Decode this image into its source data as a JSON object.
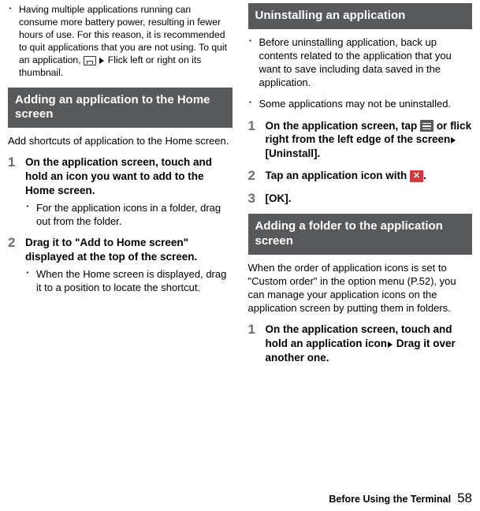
{
  "left": {
    "top_bullet": "Having multiple applications running can consume more battery power, resulting in fewer hours of use. For this reason, it is recommended to quit applications that you are not using. To quit an application, ",
    "top_bullet_after_icon": "Flick left or right on its thumbnail.",
    "heading1": "Adding an application to the Home screen",
    "intro1": "Add shortcuts of application to the Home screen.",
    "step1_title": "On the application screen, touch and hold an icon you want to add to the Home screen.",
    "step1_sub": "For the application icons in a folder, drag out from the folder.",
    "step2_title": "Drag it to \"Add to Home screen\" displayed at the top of the screen.",
    "step2_sub": "When the Home screen is displayed, drag it to a position to locate the shortcut."
  },
  "right": {
    "heading2": "Uninstalling an application",
    "bullet_a": "Before uninstalling application, back up contents related to the application that you want to save including data saved in the application.",
    "bullet_b": "Some applications may not be uninstalled.",
    "u_step1_a": "On the application screen, tap ",
    "u_step1_b": " or flick right from the left edge of the screen",
    "u_step1_c": "[Uninstall].",
    "u_step2": "Tap an application icon with ",
    "u_step2_end": ".",
    "u_step3": "[OK].",
    "heading3": "Adding a folder to the application screen",
    "intro3": "When the order of application icons is set to \"Custom order\" in the option menu (P.52), you can manage your application icons on the application screen by putting them in folders.",
    "f_step1_a": "On the application screen, touch and hold an application icon",
    "f_step1_b": "Drag it over another one."
  },
  "footer": {
    "label": "Before Using the Terminal",
    "page": "58"
  },
  "nums": {
    "n1": "1",
    "n2": "2",
    "n3": "3"
  }
}
